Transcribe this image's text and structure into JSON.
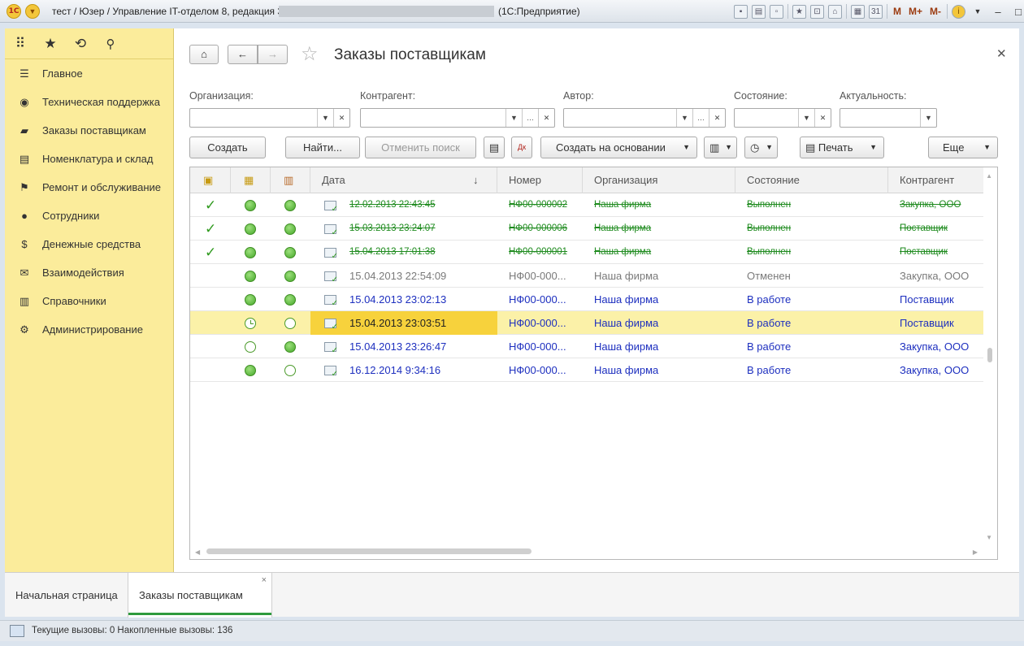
{
  "window": {
    "title": "тест / Юзер / Управление IT-отделом 8, редакция 3.0",
    "app_name": "(1С:Предприятие)",
    "toolbar_m": [
      "M",
      "M+",
      "M-"
    ]
  },
  "sidebar": {
    "items": [
      {
        "label": "Главное",
        "icon": "menu-icon"
      },
      {
        "label": "Техническая поддержка",
        "icon": "support-icon"
      },
      {
        "label": "Заказы поставщикам",
        "icon": "truck-icon"
      },
      {
        "label": "Номенклатура и склад",
        "icon": "printer-icon"
      },
      {
        "label": "Ремонт и обслуживание",
        "icon": "flag-icon"
      },
      {
        "label": "Сотрудники",
        "icon": "people-icon"
      },
      {
        "label": "Денежные средства",
        "icon": "money-bag-icon"
      },
      {
        "label": "Взаимодействия",
        "icon": "envelope-icon"
      },
      {
        "label": "Справочники",
        "icon": "books-icon"
      },
      {
        "label": "Администрирование",
        "icon": "gear-icon"
      }
    ]
  },
  "form": {
    "title": "Заказы поставщикам",
    "filters": {
      "organization_label": "Организация:",
      "counterparty_label": "Контрагент:",
      "author_label": "Автор:",
      "state_label": "Состояние:",
      "relevance_label": "Актуальность:"
    },
    "buttons": {
      "create": "Создать",
      "find": "Найти...",
      "cancel_search": "Отменить поиск",
      "create_based_on": "Создать на основании",
      "print": "Печать",
      "more": "Еще"
    }
  },
  "table": {
    "columns": [
      "Дата",
      "Номер",
      "Организация",
      "Состояние",
      "Контрагент"
    ],
    "sort_indicator": "↓",
    "rows": [
      {
        "locked": true,
        "s1": "full",
        "s2": "full",
        "date": "12.02.2013 22:43:45",
        "number": "НФ00-000002",
        "org": "Наша фирма",
        "state": "Выполнен",
        "counterparty": "Закупка, ООО",
        "style": "done"
      },
      {
        "locked": true,
        "s1": "full",
        "s2": "full",
        "date": "15.03.2013 23:24:07",
        "number": "НФ00-000006",
        "org": "Наша фирма",
        "state": "Выполнен",
        "counterparty": "Поставщик",
        "style": "done"
      },
      {
        "locked": true,
        "s1": "full",
        "s2": "full",
        "date": "15.04.2013 17:01:38",
        "number": "НФ00-000001",
        "org": "Наша фирма",
        "state": "Выполнен",
        "counterparty": "Поставщик",
        "style": "done"
      },
      {
        "locked": false,
        "s1": "full",
        "s2": "full",
        "date": "15.04.2013 22:54:09",
        "number": "НФ00-000...",
        "org": "Наша фирма",
        "state": "Отменен",
        "counterparty": "Закупка, ООО",
        "style": "cancel"
      },
      {
        "locked": false,
        "s1": "full",
        "s2": "full",
        "date": "15.04.2013 23:02:13",
        "number": "НФ00-000...",
        "org": "Наша фирма",
        "state": "В работе",
        "counterparty": "Поставщик",
        "style": "work"
      },
      {
        "locked": false,
        "s1": "clock",
        "s2": "empty",
        "date": "15.04.2013 23:03:51",
        "number": "НФ00-000...",
        "org": "Наша фирма",
        "state": "В работе",
        "counterparty": "Поставщик",
        "style": "work",
        "selected": true
      },
      {
        "locked": false,
        "s1": "empty",
        "s2": "full",
        "date": "15.04.2013 23:26:47",
        "number": "НФ00-000...",
        "org": "Наша фирма",
        "state": "В работе",
        "counterparty": "Закупка, ООО",
        "style": "work"
      },
      {
        "locked": false,
        "s1": "full",
        "s2": "empty",
        "date": "16.12.2014 9:34:16",
        "number": "НФ00-000...",
        "org": "Наша фирма",
        "state": "В работе",
        "counterparty": "Закупка, ООО",
        "style": "work"
      }
    ]
  },
  "tabs": [
    {
      "label": "Начальная страница"
    },
    {
      "label": "Заказы поставщикам"
    }
  ],
  "status": {
    "text": "Текущие вызовы: 0   Накопленные вызовы: 136"
  }
}
